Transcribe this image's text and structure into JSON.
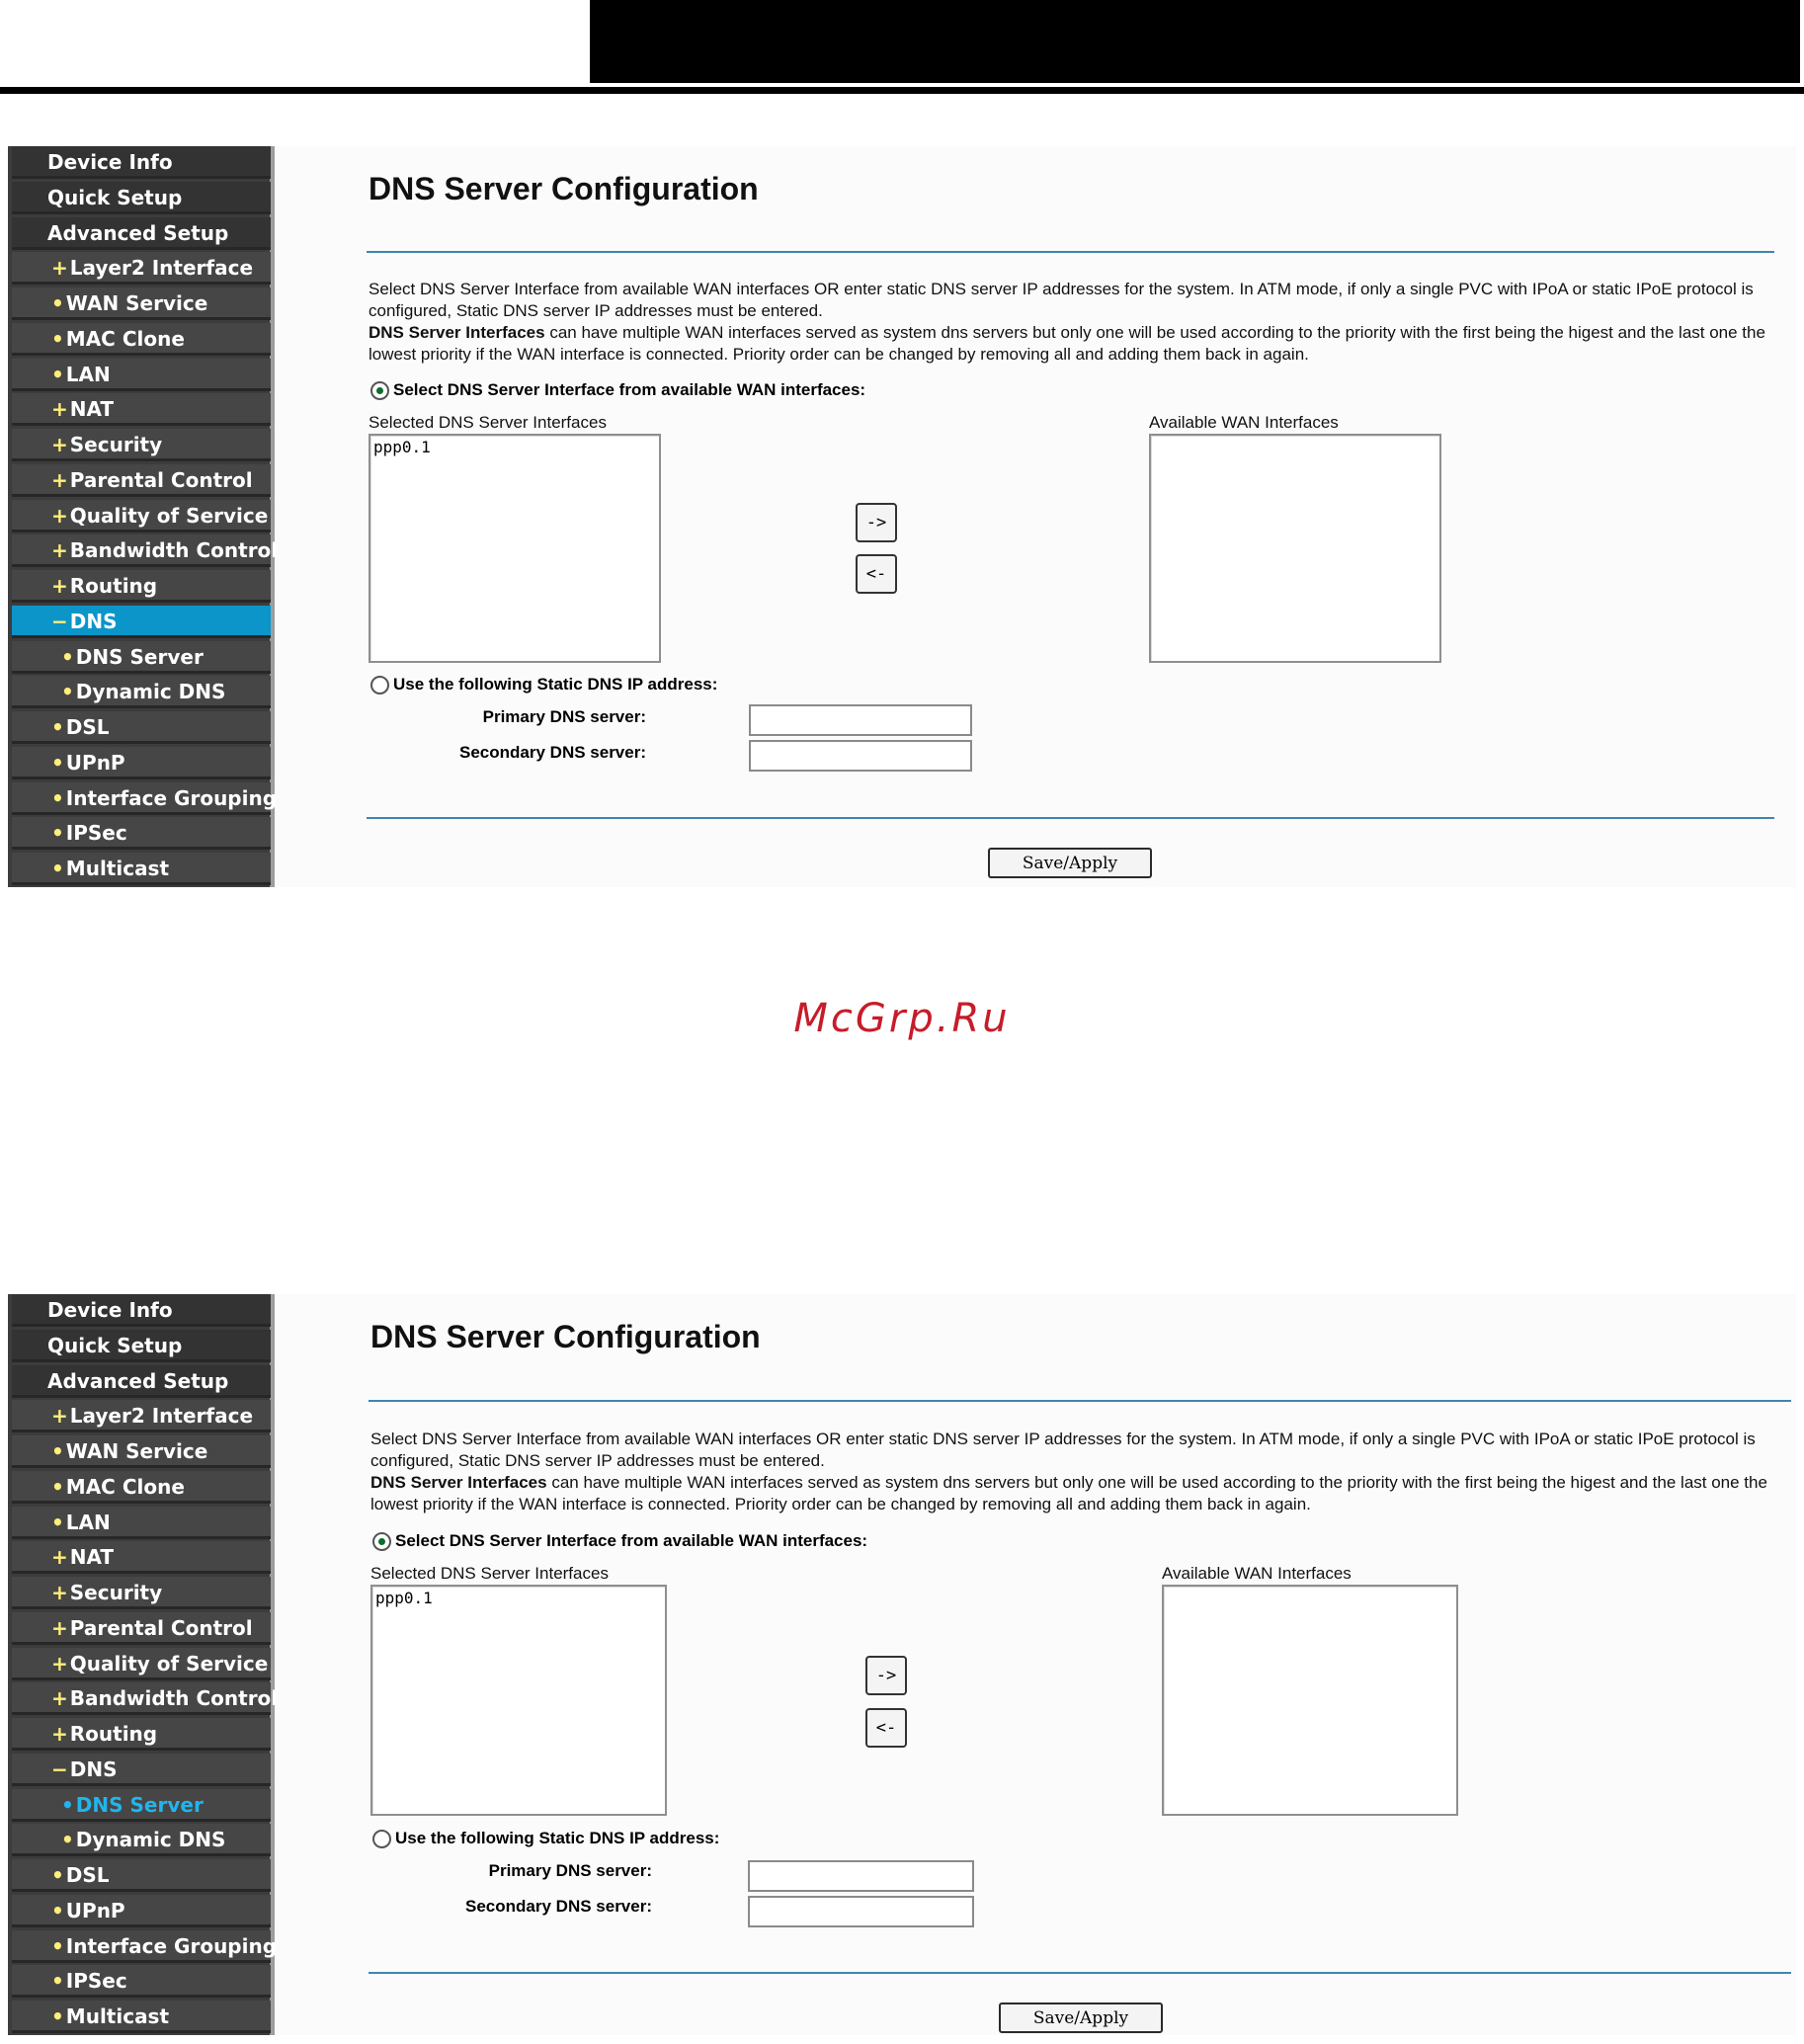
{
  "nav": [
    {
      "label": "Device Info",
      "prefix": ""
    },
    {
      "label": "Quick Setup",
      "prefix": ""
    },
    {
      "label": "Advanced Setup",
      "prefix": ""
    },
    {
      "label": "Layer2 Interface",
      "prefix": "+"
    },
    {
      "label": "WAN Service",
      "prefix": "•"
    },
    {
      "label": "MAC Clone",
      "prefix": "•"
    },
    {
      "label": "LAN",
      "prefix": "•"
    },
    {
      "label": "NAT",
      "prefix": "+"
    },
    {
      "label": "Security",
      "prefix": "+"
    },
    {
      "label": "Parental Control",
      "prefix": "+"
    },
    {
      "label": "Quality of Service",
      "prefix": "+"
    },
    {
      "label": "Bandwidth Control",
      "prefix": "+"
    },
    {
      "label": "Routing",
      "prefix": "+"
    },
    {
      "label": "DNS",
      "prefix": "−"
    },
    {
      "label": "DNS Server",
      "prefix": "•"
    },
    {
      "label": "Dynamic DNS",
      "prefix": "•"
    },
    {
      "label": "DSL",
      "prefix": "•"
    },
    {
      "label": "UPnP",
      "prefix": "•"
    },
    {
      "label": "Interface Grouping",
      "prefix": "•"
    },
    {
      "label": "IPSec",
      "prefix": "•"
    },
    {
      "label": "Multicast",
      "prefix": "•"
    }
  ],
  "page": {
    "title": "DNS Server Configuration",
    "desc_line1": "Select DNS Server Interface from available WAN interfaces OR enter static DNS server IP addresses for the system. In ATM mode, if only a single PVC with IPoA or static IPoE protocol is configured, Static DNS server IP addresses must be entered.",
    "desc_bold": "DNS Server Interfaces",
    "desc_line2": " can have multiple WAN interfaces served as system dns servers but only one will be used according to the priority with the first being the higest and the last one the lowest priority if the WAN interface is connected. Priority order can be changed by removing all and adding them back in again.",
    "radio_wan_label": "Select DNS Server Interface from available WAN interfaces:",
    "selected_label": "Selected DNS Server Interfaces",
    "selected_items": [
      "ppp0.1"
    ],
    "available_label": "Available WAN Interfaces",
    "move_right": "->",
    "move_left": "<-",
    "radio_static_label": "Use the following Static DNS IP address:",
    "primary_label": "Primary DNS server:",
    "secondary_label": "Secondary DNS server:",
    "primary_value": "",
    "secondary_value": "",
    "save_label": "Save/Apply"
  },
  "colors": {
    "active_bg": "#0b95c8",
    "current_text": "#22b4ec",
    "rule": "#3f87b0",
    "watermark": "#c61c2a"
  },
  "watermark": "McGrp.Ru"
}
